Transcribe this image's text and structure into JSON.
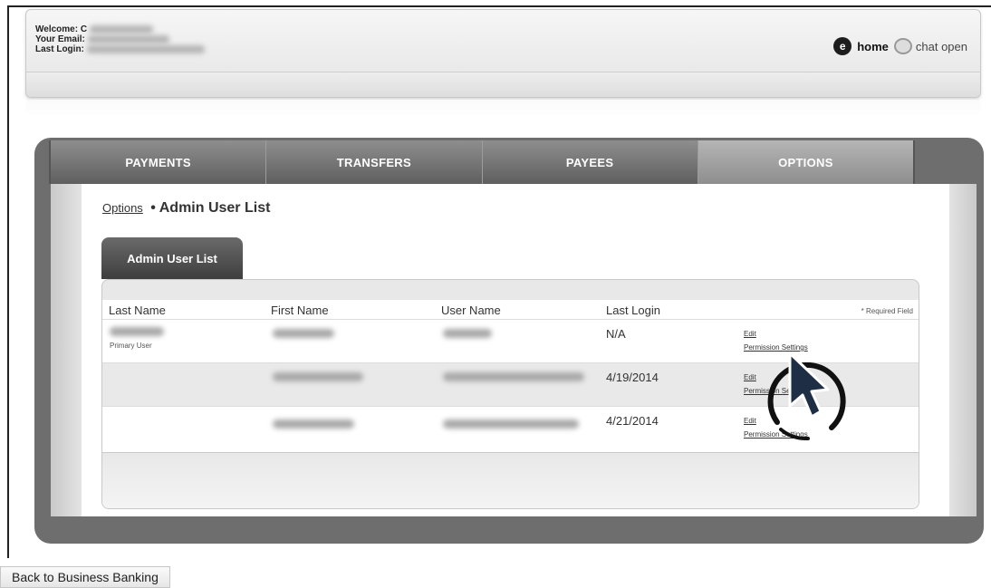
{
  "header": {
    "welcome_label": "Welcome:",
    "welcome_value_initial": "C",
    "email_label": "Your Email:",
    "last_login_label": "Last Login:",
    "home_icon_glyph": "e",
    "home_label": "home",
    "chat_label": "chat open"
  },
  "nav": {
    "tabs": [
      {
        "label": "PAYMENTS"
      },
      {
        "label": "TRANSFERS"
      },
      {
        "label": "PAYEES"
      },
      {
        "label": "OPTIONS",
        "active": true
      }
    ]
  },
  "breadcrumb": {
    "link": "Options",
    "separator": "•",
    "current": "Admin User List"
  },
  "subtab": {
    "label": "Admin User List"
  },
  "table": {
    "columns": [
      "Last Name",
      "First Name",
      "User Name",
      "Last Login"
    ],
    "required_note": "* Required Field",
    "rows": [
      {
        "last_login": "N/A",
        "role": "Primary User",
        "edit": "Edit",
        "permissions": "Permission Settings"
      },
      {
        "last_login": "4/19/2014",
        "edit": "Edit",
        "permissions": "Permission Settings"
      },
      {
        "last_login": "4/21/2014",
        "edit": "Edit",
        "permissions": "Permission Settings"
      }
    ]
  },
  "footer": {
    "back_label": "Back to Business Banking"
  },
  "colors": {
    "panel": "#6e6e6e",
    "tab_active": "#a5a5a5",
    "tab": "#7a7a7a"
  }
}
